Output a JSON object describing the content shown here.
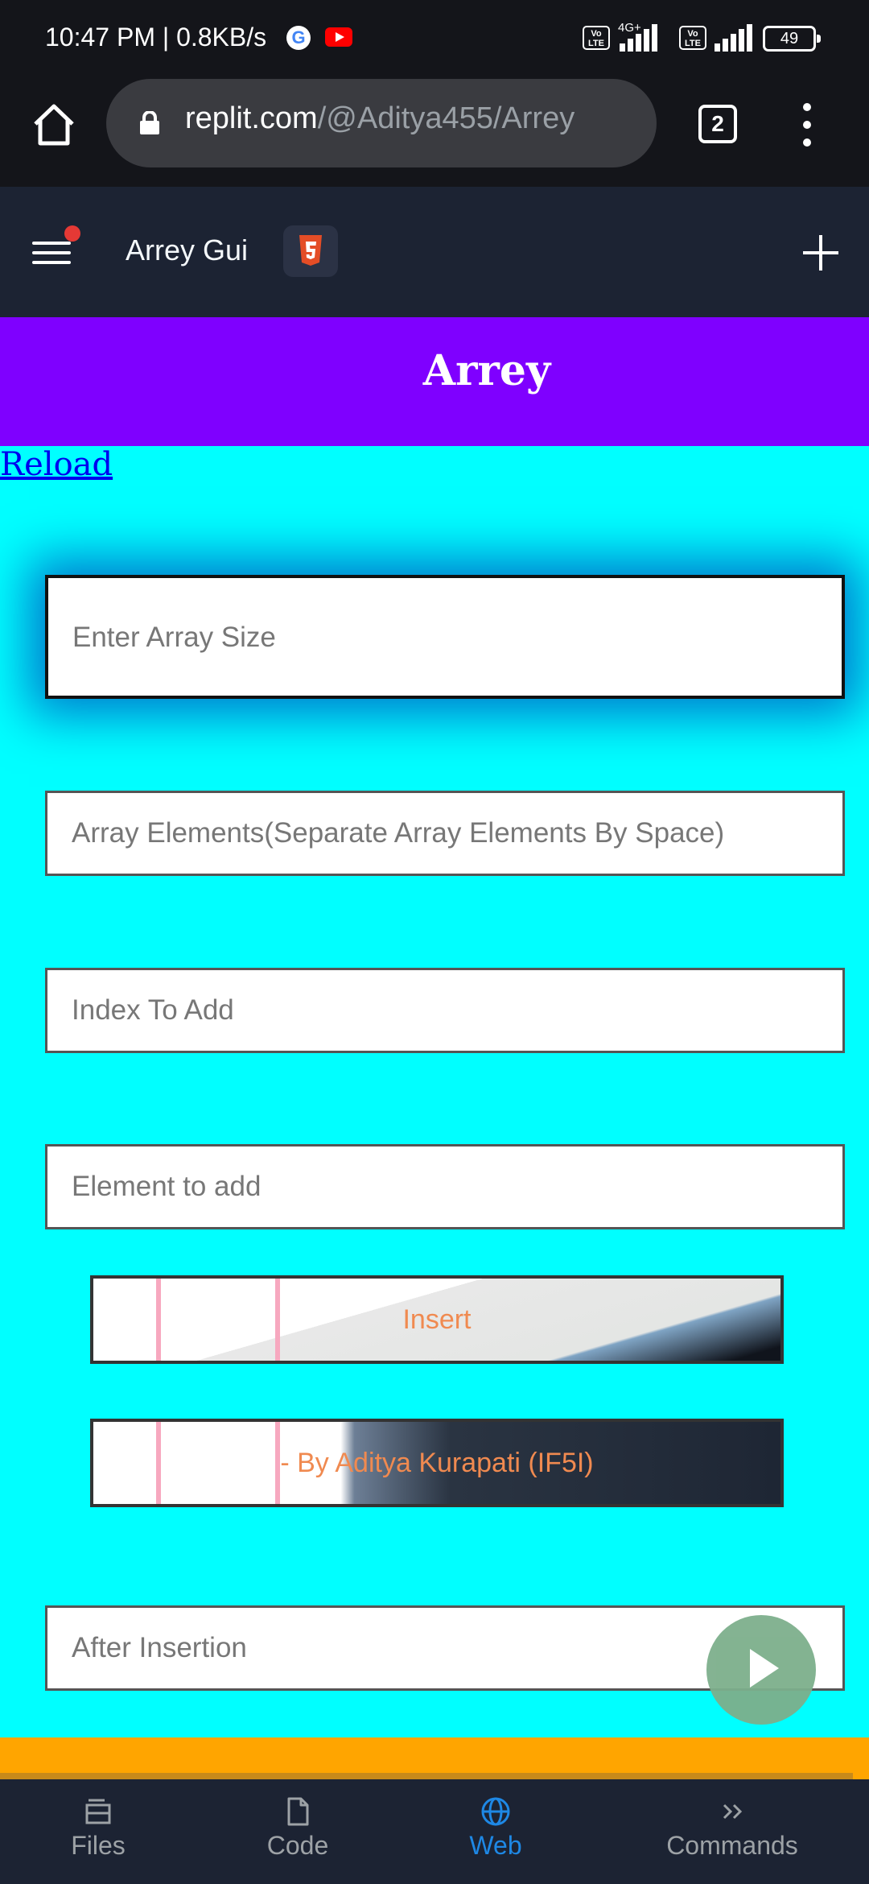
{
  "status_bar": {
    "time": "10:47 PM | 0.8KB/s",
    "network_label": "4G+",
    "volte_label": "Vo LTE",
    "battery": "49"
  },
  "browser": {
    "url_host": "replit.com",
    "url_path": "/@Aditya455/Arrey",
    "tab_count": "2"
  },
  "replit": {
    "repl_name": "Arrey Gui",
    "nav": [
      {
        "label": "Files",
        "icon": "files-icon"
      },
      {
        "label": "Code",
        "icon": "code-file-icon"
      },
      {
        "label": "Web",
        "icon": "globe-icon"
      },
      {
        "label": "Commands",
        "icon": "chevrons-right-icon"
      }
    ],
    "active_tab": "Web"
  },
  "page": {
    "title": "Arrey",
    "reload_link": "Reload",
    "fields": {
      "size_placeholder": "Enter Array Size",
      "elements_placeholder": "Array Elements(Separate Array Elements By Space)",
      "index_placeholder": "Index To Add",
      "element_placeholder": "Element to add",
      "result_placeholder": "After Insertion"
    },
    "insert_button": "Insert",
    "credit": "- By Aditya Kurapati (IF5I)"
  },
  "colors": {
    "banner": "#7f00ff",
    "page_bg": "#00ffff",
    "accent_orange": "#ffa500",
    "active_nav": "#1e88e5"
  }
}
